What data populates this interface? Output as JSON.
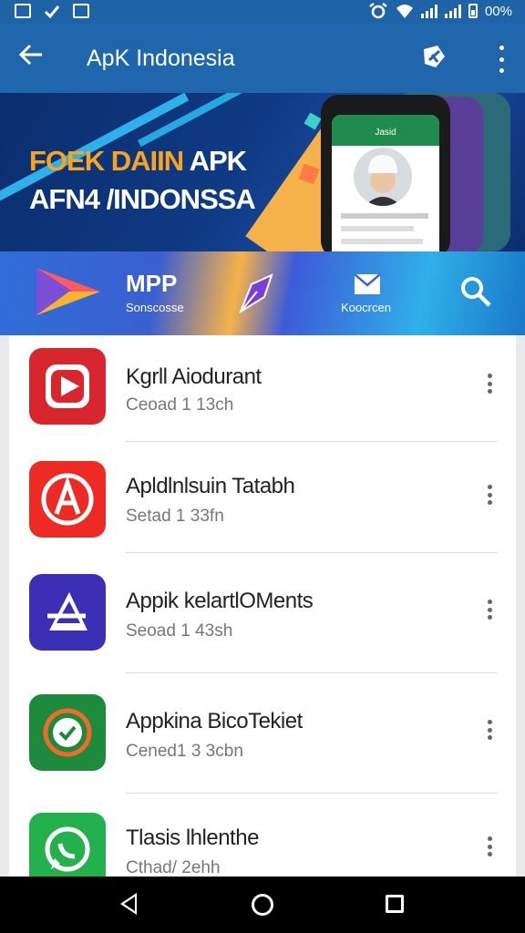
{
  "status_bar": {
    "battery_text": "00%"
  },
  "app_bar": {
    "title": "ApK Indonesia"
  },
  "banner": {
    "line1_accent": "FOEK DAIIN",
    "line1_rest": " APK",
    "line2": "AFN4 /INDONSSA",
    "phone_header": "Jasid"
  },
  "tabs": [
    {
      "title": "MPP",
      "subtitle": "Sonscosse"
    },
    {
      "label": "Koocrcen"
    }
  ],
  "apps": [
    {
      "name": "Kgrll Aiodurant",
      "sub": "Ceoad 1 13ch"
    },
    {
      "name": "Apldlnlsuin Tatabh",
      "sub": "Setad 1 33fn"
    },
    {
      "name": "Appik kelartlOMents",
      "sub": "Seoad 1 43sh"
    },
    {
      "name": "Appkina BicoTekiet",
      "sub": "Cened1 3 3cbn"
    },
    {
      "name": "Tlasis lhlenthe",
      "sub": "Cthad/ 2ehh"
    }
  ],
  "colors": {
    "app_bar": "#1f66ad",
    "status_bar": "#1e63a6",
    "banner_accent": "#f8a51d"
  }
}
